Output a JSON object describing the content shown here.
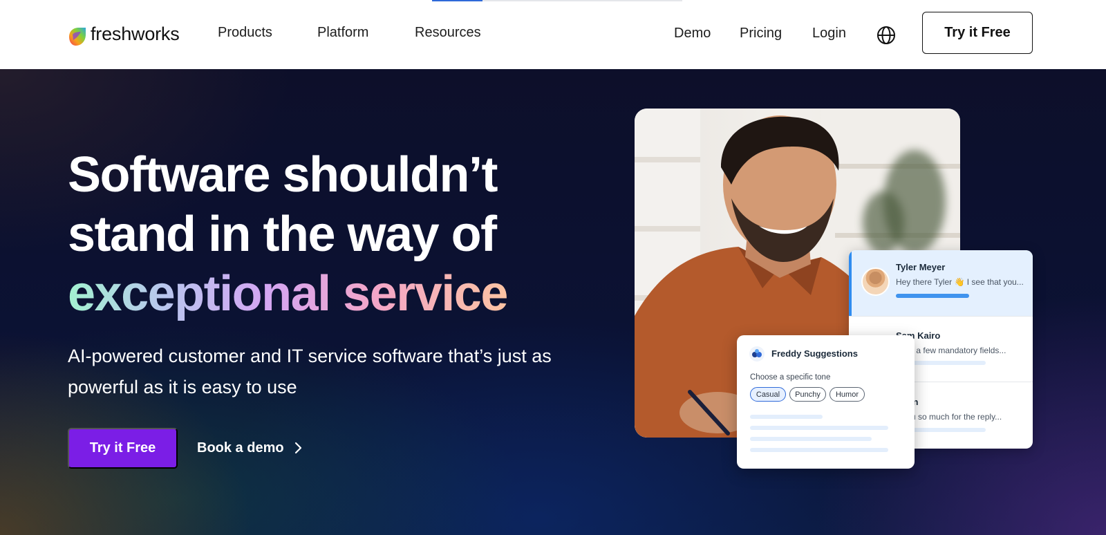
{
  "brand": {
    "name": "freshworks"
  },
  "nav": {
    "left": [
      {
        "label": "Products"
      },
      {
        "label": "Platform"
      },
      {
        "label": "Resources"
      }
    ],
    "right": [
      {
        "label": "Demo"
      },
      {
        "label": "Pricing"
      },
      {
        "label": "Login"
      }
    ],
    "globe_icon": "globe-icon",
    "cta_label": "Try it Free"
  },
  "hero": {
    "headline_line1": "Software shouldn’t",
    "headline_line2": "stand in the way of",
    "headline_highlight": "exceptional service",
    "subhead": "AI-powered customer and IT service software that’s just as powerful as it is easy to use",
    "primary_cta": "Try it Free",
    "secondary_cta": "Book a demo"
  },
  "chat_list": {
    "items": [
      {
        "name": "Tyler Meyer",
        "message": "Hey there Tyler 👋 I see that you..."
      },
      {
        "name": "Sam Kairo",
        "message": "have a few mandatory fields..."
      },
      {
        "name": "Chen",
        "message": "k you so much for the reply..."
      }
    ]
  },
  "freddy": {
    "title": "Freddy Suggestions",
    "tone_label": "Choose a specific tone",
    "tones": [
      "Casual",
      "Punchy",
      "Humor"
    ],
    "selected_tone": "Casual"
  },
  "colors": {
    "primary_purple": "#7b1ee6",
    "active_blue": "#2f8cf0",
    "hero_bg": "#0b1234"
  }
}
